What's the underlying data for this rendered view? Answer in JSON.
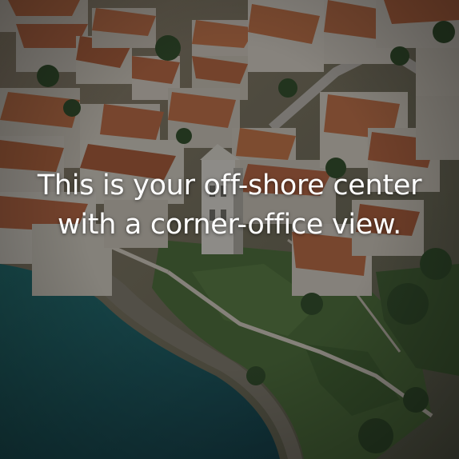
{
  "image": {
    "kind": "aerial photograph of a coastal town with terracotta roofs, a bell tower, stone walls and sea",
    "colors": {
      "roof": "#b8643c",
      "roof_shadow": "#7e3f25",
      "wall": "#c9beb0",
      "foliage": "#3f5a2c",
      "sea": "#1c5a5e",
      "overlay": "#0c1218"
    }
  },
  "headline": {
    "line1": "This is your off-shore center",
    "line2": "with a corner-office view."
  }
}
